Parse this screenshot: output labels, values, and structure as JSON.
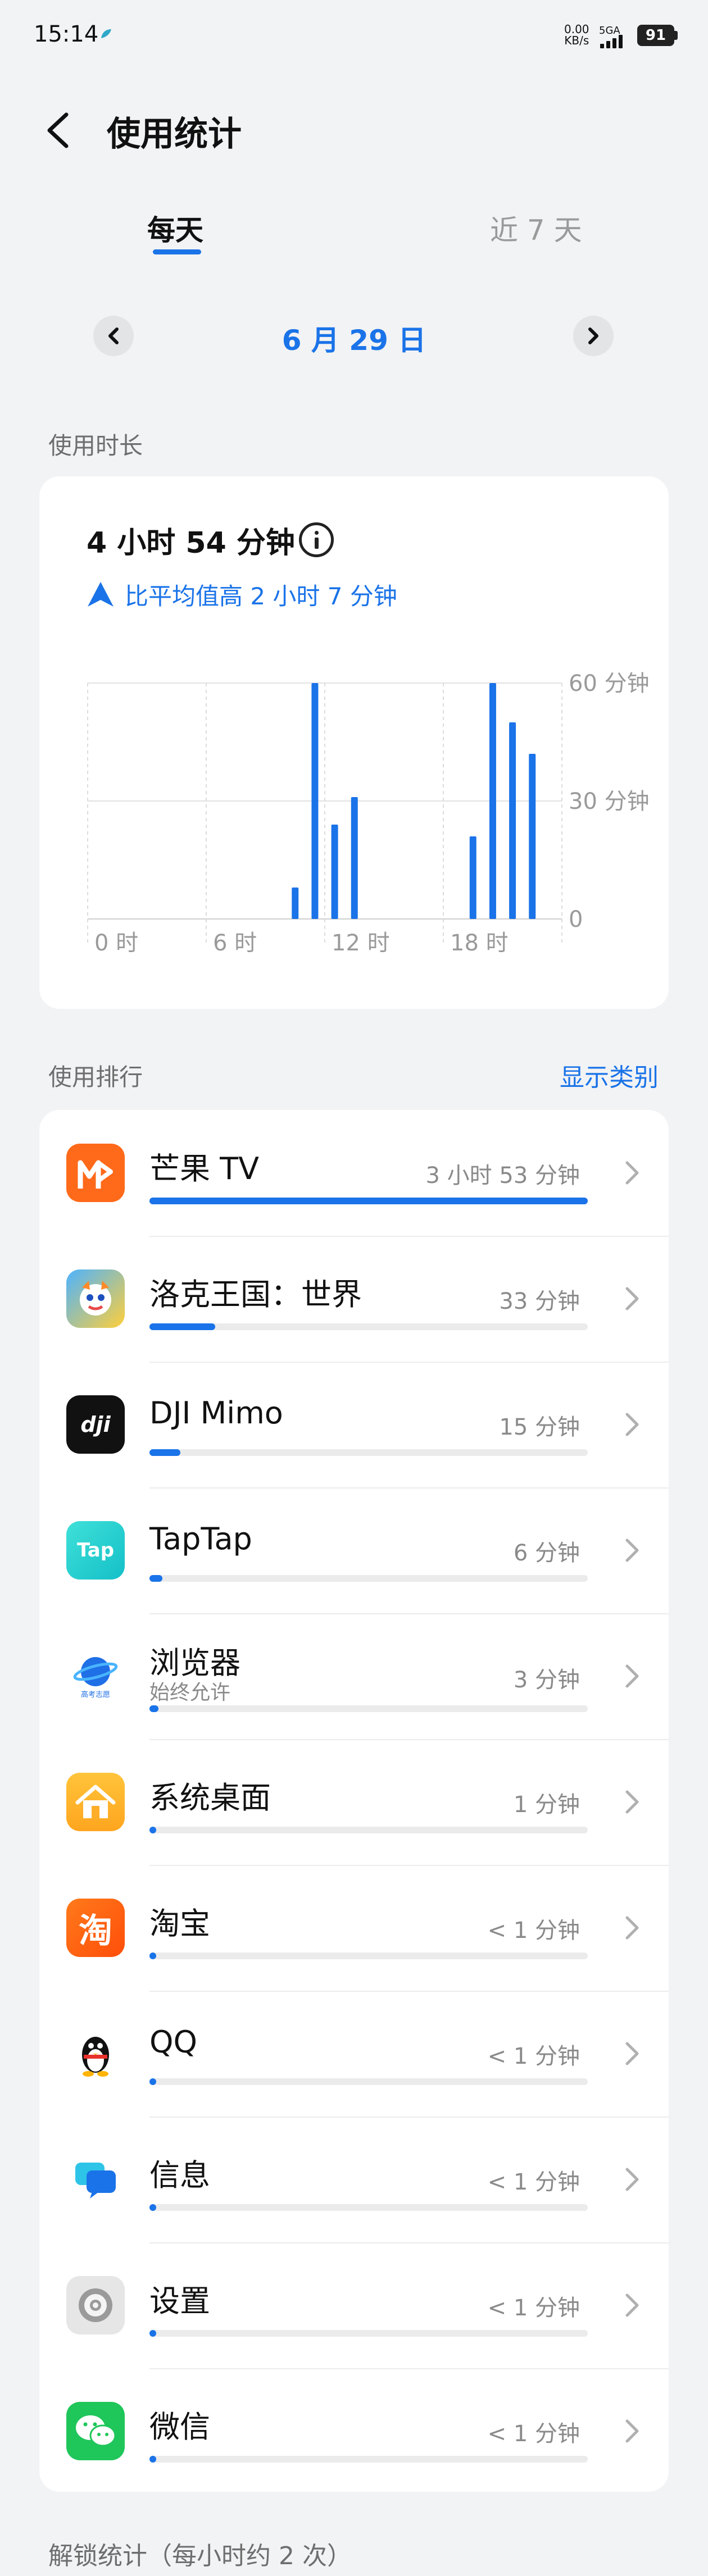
{
  "status_bar": {
    "time": "15:14",
    "net_speed_value": "0.00",
    "net_speed_unit": "KB/s",
    "signal_label": "5GA",
    "battery": "91"
  },
  "header": {
    "title": "使用统计",
    "back_icon": "chevron-left-icon"
  },
  "tabs": [
    {
      "label": "每天",
      "active": true
    },
    {
      "label": "近 7 天",
      "active": false
    }
  ],
  "date_nav": {
    "date": "6 月 29 日"
  },
  "usage_duration": {
    "section_label": "使用时长",
    "total": "4 小时 54 分钟",
    "comparison": "比平均值高 2 小时 7 分钟"
  },
  "chart_data": {
    "type": "bar",
    "x_tick_labels": [
      "0 时",
      "6 时",
      "12 时",
      "18 时"
    ],
    "y_tick_labels": [
      "60 分钟",
      "30 分钟",
      "0"
    ],
    "ylim": [
      0,
      60
    ],
    "grid": true,
    "hours": [
      0,
      1,
      2,
      3,
      4,
      5,
      6,
      7,
      8,
      9,
      10,
      11,
      12,
      13,
      14,
      15,
      16,
      17,
      18,
      19,
      20,
      21,
      22,
      23
    ],
    "values": [
      0,
      0,
      0,
      0,
      0,
      0,
      0,
      0,
      0,
      0,
      8,
      60,
      24,
      31,
      0,
      0,
      0,
      0,
      0,
      21,
      60,
      50,
      42,
      0
    ],
    "color": "#1a73e8"
  },
  "ranking": {
    "section_label": "使用排行",
    "show_category": "显示类别",
    "apps": [
      {
        "name": "芒果 TV",
        "time": "3 小时 53 分钟",
        "progress": 1.0,
        "sub": "",
        "icon": "mango-tv-icon"
      },
      {
        "name": "洛克王国：世界",
        "time": "33 分钟",
        "progress": 0.15,
        "sub": "",
        "icon": "roco-kingdom-icon"
      },
      {
        "name": "DJI Mimo",
        "time": "15 分钟",
        "progress": 0.07,
        "sub": "",
        "icon": "dji-mimo-icon"
      },
      {
        "name": "TapTap",
        "time": "6 分钟",
        "progress": 0.03,
        "sub": "",
        "icon": "taptap-icon"
      },
      {
        "name": "浏览器",
        "time": "3 分钟",
        "progress": 0.02,
        "sub": "始终允许",
        "icon": "browser-icon"
      },
      {
        "name": "系统桌面",
        "time": "1 分钟",
        "progress": 0.01,
        "sub": "",
        "icon": "home-launcher-icon"
      },
      {
        "name": "淘宝",
        "time": "< 1 分钟",
        "progress": 0.01,
        "sub": "",
        "icon": "taobao-icon"
      },
      {
        "name": "QQ",
        "time": "< 1 分钟",
        "progress": 0.01,
        "sub": "",
        "icon": "qq-penguin-icon"
      },
      {
        "name": "信息",
        "time": "< 1 分钟",
        "progress": 0.01,
        "sub": "",
        "icon": "messages-icon"
      },
      {
        "name": "设置",
        "time": "< 1 分钟",
        "progress": 0.01,
        "sub": "",
        "icon": "settings-gear-icon"
      },
      {
        "name": "微信",
        "time": "< 1 分钟",
        "progress": 0.01,
        "sub": "",
        "icon": "wechat-icon"
      }
    ]
  },
  "unlock_stats": {
    "label": "解锁统计（每小时约 2 次）"
  }
}
